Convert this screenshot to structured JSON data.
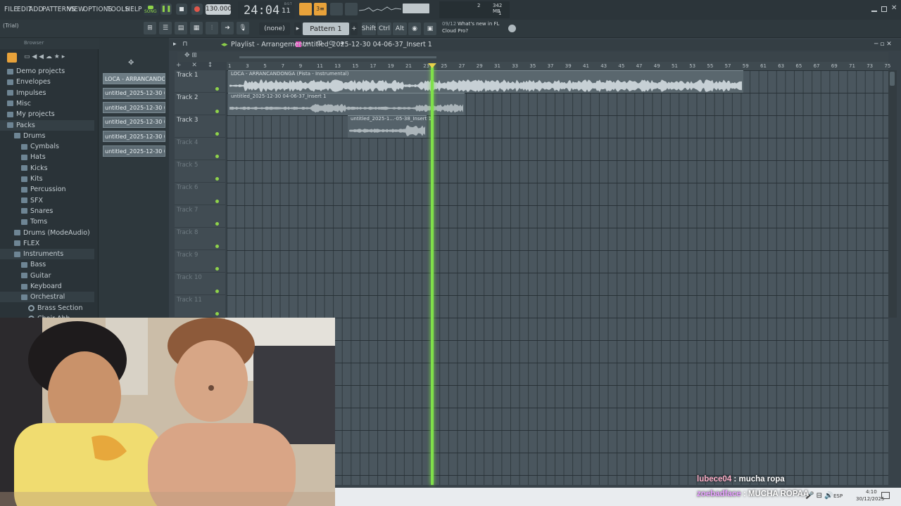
{
  "menu": [
    "FILE",
    "EDIT",
    "ADD",
    "PATTERNS",
    "VIEW",
    "OPTIONS",
    "TOOLS",
    "HELP"
  ],
  "transport": {
    "mode": "SONG",
    "tempo": "130.000",
    "time": "24:04",
    "time_sub": "11",
    "time_small": "B:S:T"
  },
  "monitor": {
    "bars": "2",
    "mem": "342 MB",
    "voices": "1"
  },
  "window": {
    "title_tag": "(Trial)"
  },
  "toolbar": {
    "none_label": "(none)",
    "pattern": "Pattern 1",
    "shift": "Shift",
    "ctrl": "Ctrl",
    "alt": "Alt",
    "news_date": "09/12",
    "news_line1": "What's new in FL",
    "news_line2": "Cloud Pro?"
  },
  "browser": {
    "title": "Browser",
    "items": [
      {
        "label": "Demo projects",
        "depth": 0
      },
      {
        "label": "Envelopes",
        "depth": 0
      },
      {
        "label": "Impulses",
        "depth": 0
      },
      {
        "label": "Misc",
        "depth": 0
      },
      {
        "label": "My projects",
        "depth": 0
      },
      {
        "label": "Packs",
        "depth": 0
      },
      {
        "label": "Drums",
        "depth": 1
      },
      {
        "label": "Cymbals",
        "depth": 2
      },
      {
        "label": "Hats",
        "depth": 2
      },
      {
        "label": "Kicks",
        "depth": 2
      },
      {
        "label": "Kits",
        "depth": 2
      },
      {
        "label": "Percussion",
        "depth": 2
      },
      {
        "label": "SFX",
        "depth": 2
      },
      {
        "label": "Snares",
        "depth": 2
      },
      {
        "label": "Toms",
        "depth": 2
      },
      {
        "label": "Drums (ModeAudio)",
        "depth": 1
      },
      {
        "label": "FLEX",
        "depth": 1
      },
      {
        "label": "Instruments",
        "depth": 1
      },
      {
        "label": "Bass",
        "depth": 2
      },
      {
        "label": "Guitar",
        "depth": 2
      },
      {
        "label": "Keyboard",
        "depth": 2
      },
      {
        "label": "Orchestral",
        "depth": 2
      },
      {
        "label": "Brass Section",
        "depth": 3
      },
      {
        "label": "Choir Ahh",
        "depth": 3
      }
    ]
  },
  "picker": [
    "LOCA - ARRANCANDO...",
    "untitled_2025-12-30 04-...",
    "untitled_2025-12-30 04-...",
    "untitled_2025-12-30 04-...",
    "untitled_2025-12-30 04-...",
    "untitled_2025-12-30 04-..."
  ],
  "playlist": {
    "crumb1": "Playlist - Arrangement",
    "crumb2": "untitled_2025-12-30 04-06-37_Insert 1",
    "ruler": [
      "1",
      "3",
      "5",
      "7",
      "9",
      "11",
      "13",
      "15",
      "17",
      "19",
      "21",
      "23",
      "25",
      "27",
      "29",
      "31",
      "33",
      "35",
      "37",
      "39",
      "41",
      "43",
      "45",
      "47",
      "49",
      "51",
      "53",
      "55",
      "57",
      "59",
      "61",
      "63",
      "65",
      "67",
      "69",
      "71",
      "73",
      "75"
    ],
    "tracks": [
      "Track 1",
      "Track 2",
      "Track 3",
      "Track 4",
      "Track 5",
      "Track 6",
      "Track 7",
      "Track 8",
      "Track 9",
      "Track 10",
      "Track 11"
    ],
    "clips": [
      {
        "title": "LOCA - ARRANCANDONGA (Pista - Instrumental)"
      },
      {
        "title": "untitled_2025-12-30 04-06-37_Insert 1"
      },
      {
        "title": "untitled_2025-1...-05-38_Insert 1"
      }
    ]
  },
  "chat": {
    "line1_user": "lubece04",
    "line1_text": "mucha ropa",
    "line2_user": "zoebadface",
    "line2_text": "MUCHA ROPAA"
  },
  "taskbar": {
    "lang": "ESP",
    "clock": "4:10",
    "date": "30/12/2025"
  }
}
